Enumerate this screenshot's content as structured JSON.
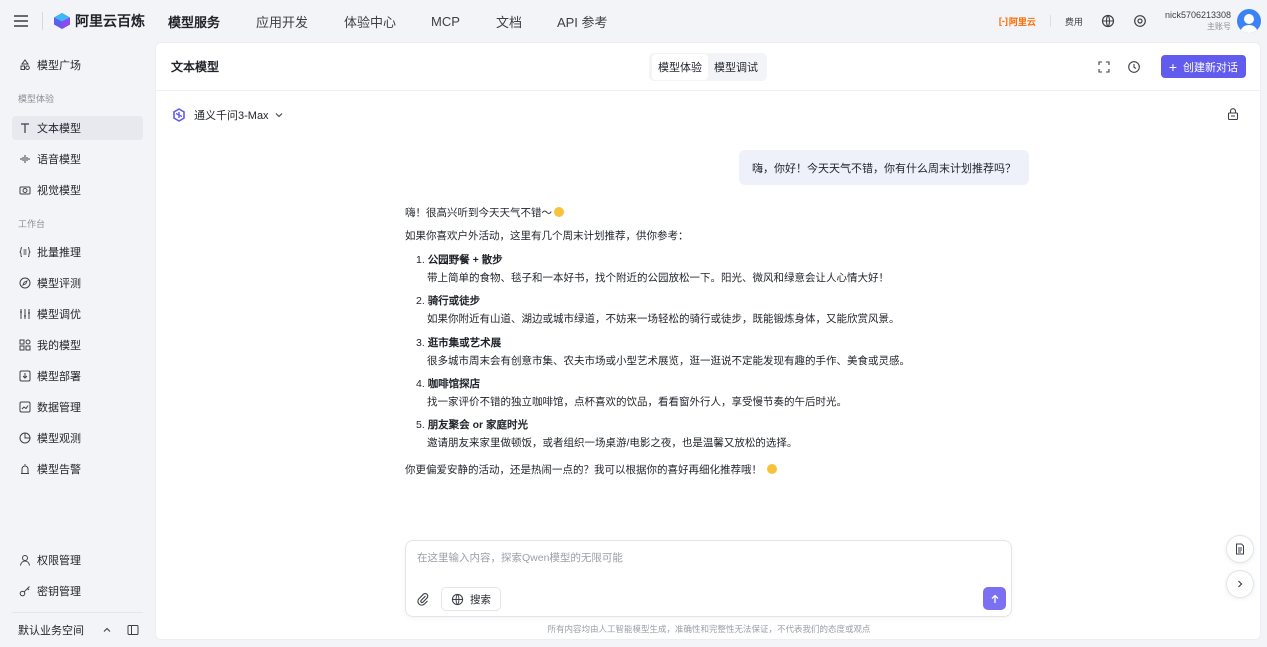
{
  "header": {
    "brand": "阿里云百炼",
    "nav": [
      "模型服务",
      "应用开发",
      "体验中心",
      "MCP",
      "文档",
      "API 参考"
    ],
    "aliyun_label": "阿里云",
    "fee_label": "费用",
    "username": "nick5706213308",
    "role": "主账号"
  },
  "sidebar": {
    "top_item": "模型广场",
    "group1": "模型体验",
    "group1_items": [
      "文本模型",
      "语音模型",
      "视觉模型"
    ],
    "group2": "工作台",
    "group2_items": [
      "批量推理",
      "模型评测",
      "模型调优",
      "我的模型",
      "模型部署",
      "数据管理",
      "模型观测",
      "模型告警"
    ],
    "bottom_items": [
      "权限管理",
      "密钥管理"
    ],
    "workspace": "默认业务空间"
  },
  "main": {
    "title": "文本模型",
    "tabs": [
      "模型体验",
      "模型调试"
    ],
    "active_tab": "模型体验",
    "new_chat_label": "创建新对话",
    "model_name": "通义千问3-Max",
    "user_message": "嗨，你好！今天天气不错，你有什么周末计划推荐吗？",
    "answer": {
      "greeting": "嗨！很高兴听到今天天气不错～",
      "intro": "如果你喜欢户外活动，这里有几个周末计划推荐，供你参考：",
      "items": [
        {
          "num": "1.",
          "title": "公园野餐 + 散步",
          "desc": "带上简单的食物、毯子和一本好书，找个附近的公园放松一下。阳光、微风和绿意会让人心情大好！"
        },
        {
          "num": "2.",
          "title": "骑行或徒步",
          "desc": "如果你附近有山道、湖边或城市绿道，不妨来一场轻松的骑行或徒步，既能锻炼身体，又能欣赏风景。"
        },
        {
          "num": "3.",
          "title": "逛市集或艺术展",
          "desc": "很多城市周末会有创意市集、农夫市场或小型艺术展览，逛一逛说不定能发现有趣的手作、美食或灵感。"
        },
        {
          "num": "4.",
          "title": "咖啡馆探店",
          "desc": "找一家评价不错的独立咖啡馆，点杯喜欢的饮品，看看窗外行人，享受慢节奏的午后时光。"
        },
        {
          "num": "5.",
          "title": "朋友聚会 or 家庭时光",
          "desc": "邀请朋友来家里做顿饭，或者组织一场桌游/电影之夜，也是温馨又放松的选择。"
        }
      ],
      "closing": "你更偏爱安静的活动，还是热闹一点的？我可以根据你的喜好再细化推荐哦！"
    },
    "input_placeholder": "在这里输入内容，探索Qwen模型的无限可能",
    "search_label": "搜索",
    "disclaimer": "所有内容均由人工智能模型生成，准确性和完整性无法保证，不代表我们的态度或观点"
  },
  "colors": {
    "accent": "#615ced",
    "aliyun": "#ff6a00",
    "avatar": "#3b82f6"
  }
}
